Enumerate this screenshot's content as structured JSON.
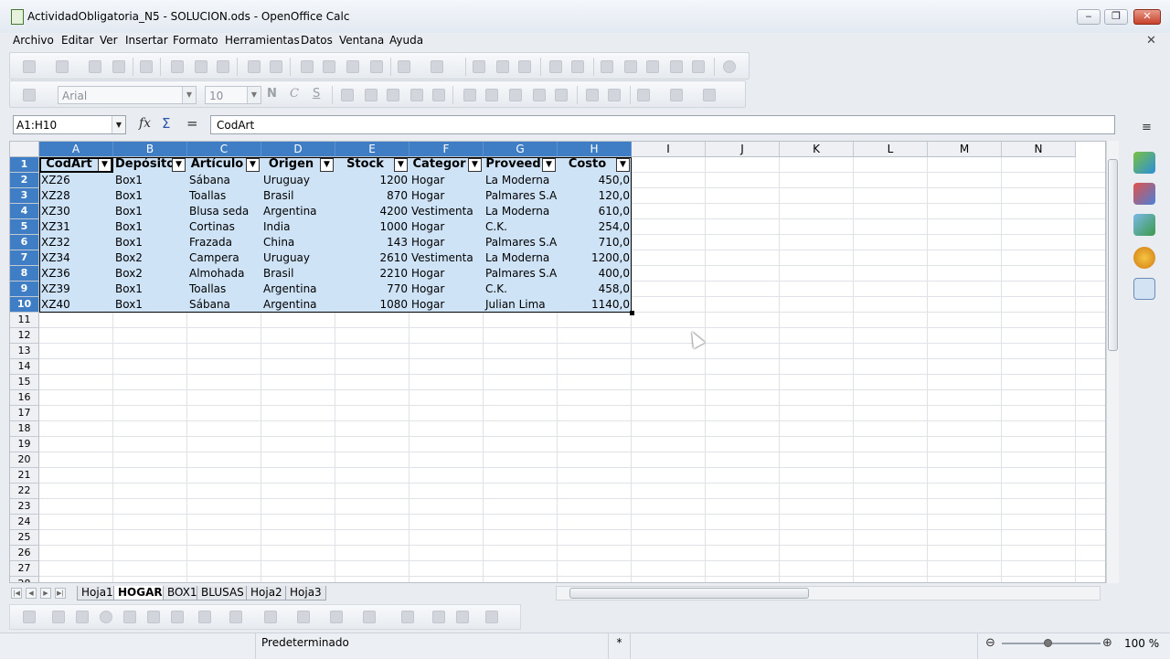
{
  "window": {
    "title": "ActividadObligatoria_N5 - SOLUCION.ods - OpenOffice Calc",
    "minimize_label": "‒",
    "maximize_label": "❐",
    "close_label": "✕"
  },
  "menu": [
    "Archivo",
    "Editar",
    "Ver",
    "Insertar",
    "Formato",
    "Herramientas",
    "Datos",
    "Ventana",
    "Ayuda"
  ],
  "doc_close_label": "✕",
  "format_toolbar": {
    "font_name": "Arial",
    "font_size": "10",
    "bold_label": "N",
    "italic_label": "C",
    "underline_label": "S"
  },
  "formula_bar": {
    "name_box": "A1:H10",
    "content": "CodArt",
    "fx_label": "fx",
    "sum_label": "Σ",
    "equal_label": "="
  },
  "columns": [
    "A",
    "B",
    "C",
    "D",
    "E",
    "F",
    "G",
    "H",
    "I",
    "J",
    "K",
    "L",
    "M",
    "N"
  ],
  "selected_columns": [
    "A",
    "B",
    "C",
    "D",
    "E",
    "F",
    "G",
    "H"
  ],
  "rows": [
    "1",
    "2",
    "3",
    "4",
    "5",
    "6",
    "7",
    "8",
    "9",
    "10",
    "11",
    "12",
    "13",
    "14",
    "15",
    "16",
    "17",
    "18",
    "19",
    "20",
    "21",
    "22",
    "23",
    "24",
    "25",
    "26",
    "27",
    "28"
  ],
  "table": {
    "headers": [
      "CodArt",
      "Depósito",
      "Artículo",
      "Origen",
      "Stock",
      "Categor",
      "Proveed",
      "Costo"
    ],
    "rows": [
      [
        "XZ26",
        "Box1",
        "Sábana",
        "Uruguay",
        "1200",
        "Hogar",
        "La Moderna",
        "450,0"
      ],
      [
        "XZ28",
        "Box1",
        "Toallas",
        "Brasil",
        "870",
        "Hogar",
        "Palmares S.A",
        "120,0"
      ],
      [
        "XZ30",
        "Box1",
        "Blusa seda",
        "Argentina",
        "4200",
        "Vestimenta",
        "La Moderna",
        "610,0"
      ],
      [
        "XZ31",
        "Box1",
        "Cortinas",
        "India",
        "1000",
        "Hogar",
        "C.K.",
        "254,0"
      ],
      [
        "XZ32",
        "Box1",
        "Frazada",
        "China",
        "143",
        "Hogar",
        "Palmares S.A",
        "710,0"
      ],
      [
        "XZ34",
        "Box2",
        "Campera",
        "Uruguay",
        "2610",
        "Vestimenta",
        "La Moderna",
        "1200,0"
      ],
      [
        "XZ36",
        "Box2",
        "Almohada",
        "Brasil",
        "2210",
        "Hogar",
        "Palmares S.A",
        "400,0"
      ],
      [
        "XZ39",
        "Box1",
        "Toallas",
        "Argentina",
        "770",
        "Hogar",
        "C.K.",
        "458,0"
      ],
      [
        "XZ40",
        "Box1",
        "Sábana",
        "Argentina",
        "1080",
        "Hogar",
        "Julian Lima",
        "1140,0"
      ]
    ]
  },
  "sheet_tabs": [
    "Hoja1",
    "HOGAR",
    "BOX1",
    "BLUSAS",
    "Hoja2",
    "Hoja3"
  ],
  "active_tab": "HOGAR",
  "statusbar": {
    "page_style": "Predeterminado",
    "modified": "*",
    "zoom": "100 %",
    "zoom_out": "⊖",
    "zoom_in": "⊕"
  },
  "icons": {
    "app": "calc-document-icon",
    "sidebar": [
      "sidebar-menu-icon",
      "properties-icon",
      "styles-icon",
      "gallery-icon",
      "navigator-icon",
      "functions-icon"
    ]
  },
  "colors": {
    "selection": "#cfe3f7",
    "header_selected": "#3f7ec5",
    "close_button": "#c6412a"
  }
}
